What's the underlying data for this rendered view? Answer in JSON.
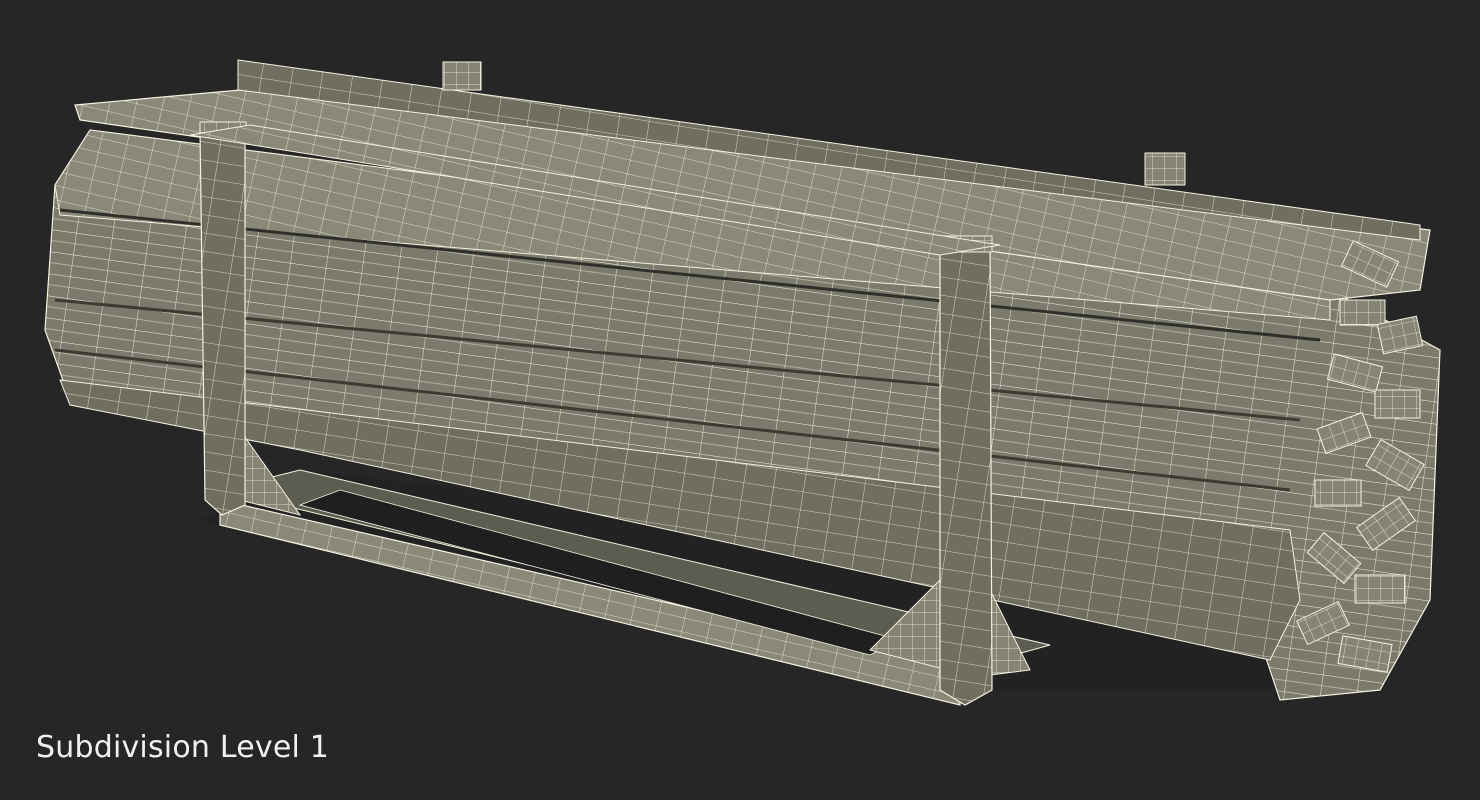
{
  "caption": "Subdivision Level 1",
  "colors": {
    "background": "#262626",
    "mesh_fill": "#7b7a6c",
    "mesh_shadow": "#4e4d44",
    "wire": "#f4f1e0",
    "caption_text": "#f0f0f0"
  }
}
